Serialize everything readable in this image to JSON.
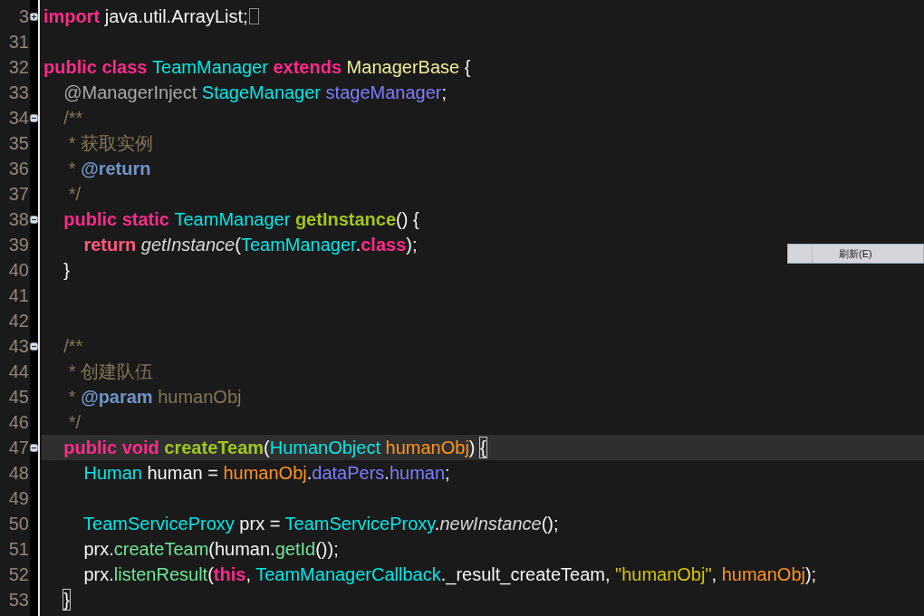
{
  "editor": {
    "lines": [
      {
        "number": "3",
        "kind": "fold",
        "collapsed": true,
        "current": false,
        "tokens": [
          {
            "text": "import",
            "kind": "keyword"
          },
          {
            "text": " java.util.ArrayList;",
            "kind": "plain"
          }
        ]
      },
      {
        "number": "31",
        "kind": "code",
        "current": false
      },
      {
        "number": "32",
        "kind": "code",
        "current": false,
        "tokens": [
          {
            "text": "public class ",
            "kind": "keyword"
          },
          {
            "text": "TeamManager",
            "kind": "type"
          },
          {
            "text": " extends ",
            "kind": "keyword"
          },
          {
            "text": "ManagerBase",
            "kind": "supertype"
          },
          {
            "text": " {",
            "kind": "plain"
          }
        ]
      },
      {
        "number": "33",
        "kind": "code",
        "current": false,
        "tokens": [
          {
            "text": "    @ManagerInject ",
            "kind": "annotation"
          },
          {
            "text": "StageManager",
            "kind": "type"
          },
          {
            "text": " stageManager",
            "kind": "field"
          },
          {
            "text": ";",
            "kind": "plain"
          }
        ]
      },
      {
        "number": "34",
        "kind": "fold",
        "collapsed": false,
        "current": false,
        "tokens": [
          {
            "text": "    /**",
            "kind": "comment"
          }
        ]
      },
      {
        "number": "35",
        "kind": "code",
        "current": false,
        "tokens": [
          {
            "text": "     * 获取实例",
            "kind": "comment"
          }
        ]
      },
      {
        "number": "36",
        "kind": "code",
        "current": false,
        "tokens": [
          {
            "text": "     * ",
            "kind": "comment"
          },
          {
            "text": "@return",
            "kind": "doctag"
          }
        ]
      },
      {
        "number": "37",
        "kind": "code",
        "current": false,
        "tokens": [
          {
            "text": "     */",
            "kind": "comment"
          }
        ]
      },
      {
        "number": "38",
        "kind": "fold",
        "collapsed": false,
        "current": false,
        "tokens": [
          {
            "text": "    public static ",
            "kind": "keyword"
          },
          {
            "text": "TeamManager",
            "kind": "type"
          },
          {
            "text": " getInstance",
            "kind": "method-decl"
          },
          {
            "text": "() {",
            "kind": "plain"
          }
        ]
      },
      {
        "number": "39",
        "kind": "code",
        "current": false,
        "tokens": [
          {
            "text": "        return ",
            "kind": "return"
          },
          {
            "text": "getInstance",
            "kind": "static-call"
          },
          {
            "text": "(",
            "kind": "plain"
          },
          {
            "text": "TeamManager",
            "kind": "type"
          },
          {
            "text": ".",
            "kind": "plain"
          },
          {
            "text": "class",
            "kind": "keyword"
          },
          {
            "text": ");",
            "kind": "plain"
          }
        ]
      },
      {
        "number": "40",
        "kind": "code",
        "current": false,
        "tokens": [
          {
            "text": "    }",
            "kind": "plain"
          }
        ]
      },
      {
        "number": "41",
        "kind": "code",
        "current": false
      },
      {
        "number": "42",
        "kind": "code",
        "current": false
      },
      {
        "number": "43",
        "kind": "fold",
        "collapsed": false,
        "current": false,
        "tokens": [
          {
            "text": "    /**",
            "kind": "comment"
          }
        ]
      },
      {
        "number": "44",
        "kind": "code",
        "current": false,
        "tokens": [
          {
            "text": "     * 创建队伍",
            "kind": "comment"
          }
        ]
      },
      {
        "number": "45",
        "kind": "code",
        "current": false,
        "tokens": [
          {
            "text": "     * ",
            "kind": "comment"
          },
          {
            "text": "@param",
            "kind": "doctag"
          },
          {
            "text": " humanObj",
            "kind": "comment"
          }
        ]
      },
      {
        "number": "46",
        "kind": "code",
        "current": false,
        "tokens": [
          {
            "text": "     */",
            "kind": "comment"
          }
        ]
      },
      {
        "number": "47",
        "kind": "fold",
        "collapsed": false,
        "current": true,
        "tokens": [
          {
            "text": "    public void ",
            "kind": "keyword"
          },
          {
            "text": "createTeam",
            "kind": "method-decl"
          },
          {
            "text": "(",
            "kind": "plain"
          },
          {
            "text": "HumanObject",
            "kind": "type"
          },
          {
            "text": " humanObj",
            "kind": "param"
          },
          {
            "text": ") ",
            "kind": "plain"
          },
          {
            "text": "{",
            "kind": "plain",
            "matched": true
          }
        ]
      },
      {
        "number": "48",
        "kind": "code",
        "current": false,
        "tokens": [
          {
            "text": "        Human",
            "kind": "type"
          },
          {
            "text": " human = ",
            "kind": "plain"
          },
          {
            "text": "humanObj",
            "kind": "param"
          },
          {
            "text": ".",
            "kind": "plain"
          },
          {
            "text": "dataPers",
            "kind": "field"
          },
          {
            "text": ".",
            "kind": "plain"
          },
          {
            "text": "human",
            "kind": "field"
          },
          {
            "text": ";",
            "kind": "plain"
          }
        ]
      },
      {
        "number": "49",
        "kind": "code",
        "current": false
      },
      {
        "number": "50",
        "kind": "code",
        "current": false,
        "tokens": [
          {
            "text": "        TeamServiceProxy",
            "kind": "type"
          },
          {
            "text": " prx = ",
            "kind": "plain"
          },
          {
            "text": "TeamServiceProxy",
            "kind": "type"
          },
          {
            "text": ".",
            "kind": "plain"
          },
          {
            "text": "newInstance",
            "kind": "static-call"
          },
          {
            "text": "();",
            "kind": "plain"
          }
        ]
      },
      {
        "number": "51",
        "kind": "code",
        "current": false,
        "tokens": [
          {
            "text": "        prx.",
            "kind": "plain"
          },
          {
            "text": "createTeam",
            "kind": "method-call"
          },
          {
            "text": "(human.",
            "kind": "plain"
          },
          {
            "text": "getId",
            "kind": "method-call"
          },
          {
            "text": "());",
            "kind": "plain"
          }
        ]
      },
      {
        "number": "52",
        "kind": "code",
        "current": false,
        "tokens": [
          {
            "text": "        prx.",
            "kind": "plain"
          },
          {
            "text": "listenResult",
            "kind": "method-call"
          },
          {
            "text": "(",
            "kind": "plain"
          },
          {
            "text": "this",
            "kind": "keyword"
          },
          {
            "text": ", ",
            "kind": "plain"
          },
          {
            "text": "TeamManagerCallback",
            "kind": "type"
          },
          {
            "text": "._result_createTeam, ",
            "kind": "plain"
          },
          {
            "text": "\"humanObj\"",
            "kind": "string"
          },
          {
            "text": ", ",
            "kind": "plain"
          },
          {
            "text": "humanObj",
            "kind": "param"
          },
          {
            "text": ");",
            "kind": "plain"
          }
        ]
      },
      {
        "number": "53",
        "kind": "code",
        "current": false,
        "tokens": [
          {
            "text": "    }",
            "kind": "plain",
            "matched": true
          }
        ]
      }
    ]
  },
  "context_menu": {
    "items": [
      {
        "label": "刷新(E)"
      }
    ]
  }
}
